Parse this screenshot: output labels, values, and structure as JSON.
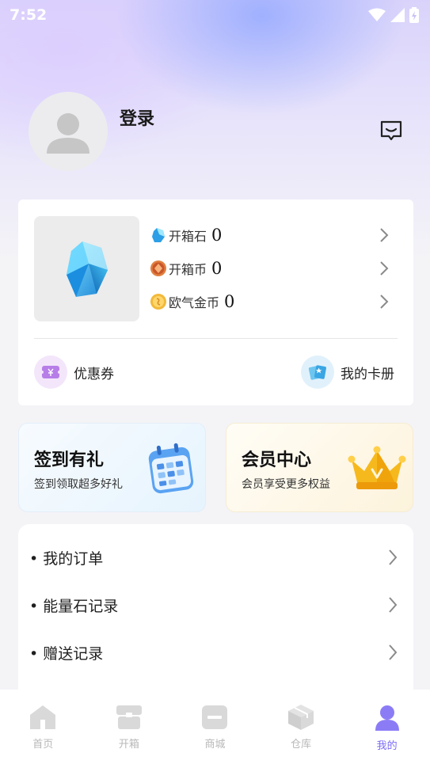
{
  "status_bar": {
    "time": "7:52"
  },
  "profile": {
    "login_label": "登录"
  },
  "wallet": {
    "currencies": [
      {
        "name": "开箱石",
        "value": "0",
        "icon": "crystal-icon"
      },
      {
        "name": "开箱币",
        "value": "0",
        "icon": "copper-coin-icon"
      },
      {
        "name": "欧气金币",
        "value": "0",
        "icon": "gold-coin-icon"
      }
    ],
    "quick_links": [
      {
        "label": "优惠券",
        "icon": "coupon-icon"
      },
      {
        "label": "我的卡册",
        "icon": "card-album-icon"
      }
    ]
  },
  "promos": [
    {
      "title": "签到有礼",
      "subtitle": "签到领取超多好礼",
      "icon": "calendar-icon"
    },
    {
      "title": "会员中心",
      "subtitle": "会员享受更多权益",
      "icon": "crown-icon"
    }
  ],
  "menu": [
    {
      "label": "• 我的订单"
    },
    {
      "label": "• 能量石记录"
    },
    {
      "label": "• 赠送记录"
    }
  ],
  "tabs": [
    {
      "label": "首页",
      "icon": "home-icon"
    },
    {
      "label": "开箱",
      "icon": "box-icon"
    },
    {
      "label": "商城",
      "icon": "shop-icon"
    },
    {
      "label": "仓库",
      "icon": "warehouse-icon"
    },
    {
      "label": "我的",
      "icon": "profile-icon",
      "active": true
    }
  ],
  "colors": {
    "accent": "#7b6bf5",
    "tab_inactive": "#b8b8b8"
  }
}
